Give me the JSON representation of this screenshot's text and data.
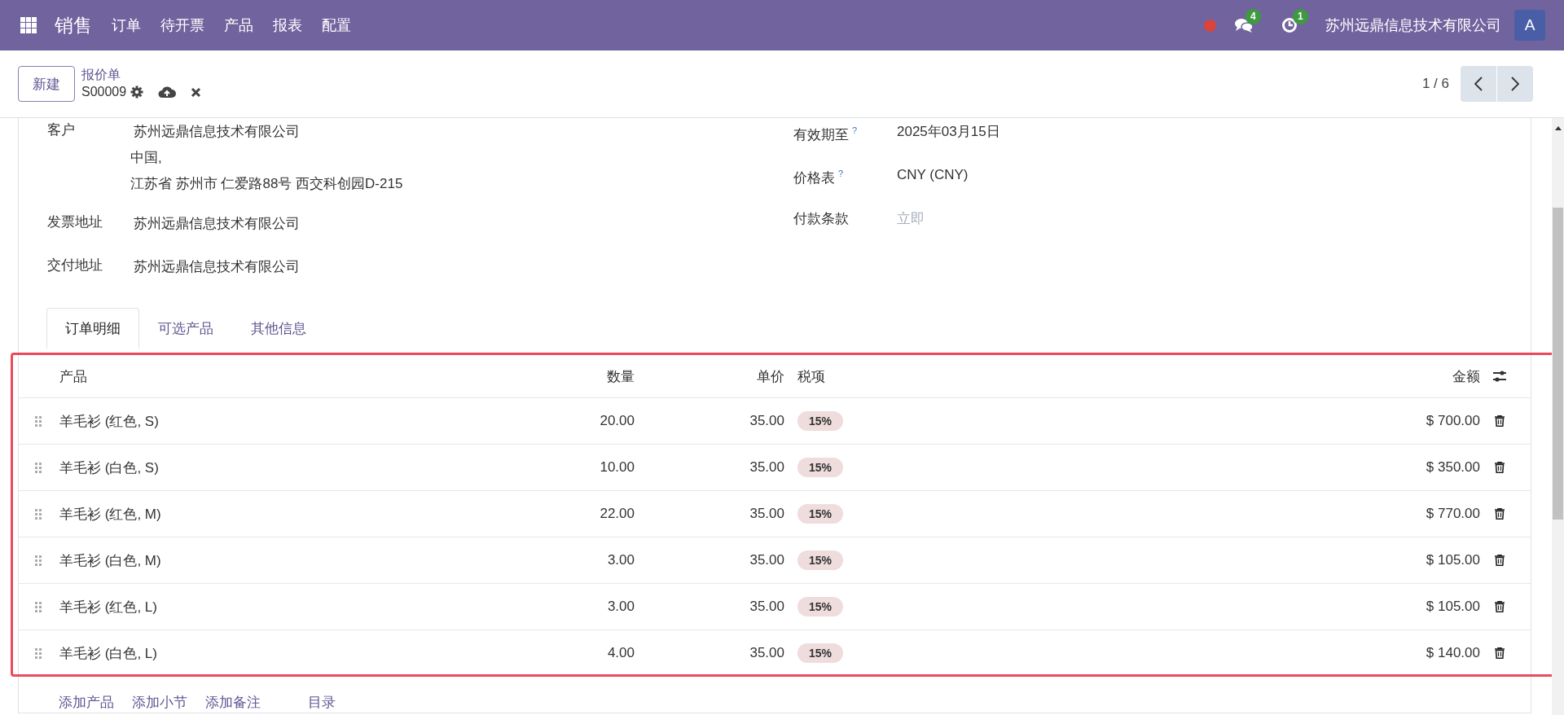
{
  "navbar": {
    "app": "销售",
    "menu": [
      "订单",
      "待开票",
      "产品",
      "报表",
      "配置"
    ],
    "messages_badge": "4",
    "activity_badge": "1",
    "company": "苏州远鼎信息技术有限公司",
    "avatar": "A"
  },
  "control_panel": {
    "new_button": "新建",
    "breadcrumb": "报价单",
    "record": "S00009",
    "pager": "1 / 6"
  },
  "form": {
    "left_fields": [
      {
        "label": "客户",
        "lines": [
          "苏州远鼎信息技术有限公司",
          "中国,",
          "江苏省 苏州市 仁爱路88号 西交科创园D-215"
        ]
      },
      {
        "label": "发票地址",
        "lines": [
          "苏州远鼎信息技术有限公司"
        ]
      },
      {
        "label": "交付地址",
        "lines": [
          "苏州远鼎信息技术有限公司"
        ]
      }
    ],
    "right_fields": [
      {
        "label": "有效期至",
        "help": "?",
        "value": "2025年03月15日"
      },
      {
        "label": "价格表",
        "help": "?",
        "value": "CNY (CNY)"
      },
      {
        "label": "付款条款",
        "placeholder": "立即"
      }
    ]
  },
  "tabs": [
    {
      "label": "订单明细",
      "selected": true
    },
    {
      "label": "可选产品",
      "selected": false
    },
    {
      "label": "其他信息",
      "selected": false
    }
  ],
  "table": {
    "highlighted": true,
    "columns": [
      "产品",
      "数量",
      "单价",
      "税项",
      "金额"
    ],
    "rows": [
      {
        "product": "羊毛衫 (红色, S)",
        "quantity": "20.00",
        "unit_price": "35.00",
        "tax": "15%",
        "amount": "$ 700.00"
      },
      {
        "product": "羊毛衫 (白色, S)",
        "quantity": "10.00",
        "unit_price": "35.00",
        "tax": "15%",
        "amount": "$ 350.00"
      },
      {
        "product": "羊毛衫 (红色, M)",
        "quantity": "22.00",
        "unit_price": "35.00",
        "tax": "15%",
        "amount": "$ 770.00"
      },
      {
        "product": "羊毛衫 (白色, M)",
        "quantity": "3.00",
        "unit_price": "35.00",
        "tax": "15%",
        "amount": "$ 105.00"
      },
      {
        "product": "羊毛衫 (红色, L)",
        "quantity": "3.00",
        "unit_price": "35.00",
        "tax": "15%",
        "amount": "$ 105.00"
      },
      {
        "product": "羊毛衫 (白色, L)",
        "quantity": "4.00",
        "unit_price": "35.00",
        "tax": "15%",
        "amount": "$ 140.00"
      }
    ],
    "actions": [
      "添加产品",
      "添加小节",
      "添加备注",
      "目录"
    ]
  }
}
